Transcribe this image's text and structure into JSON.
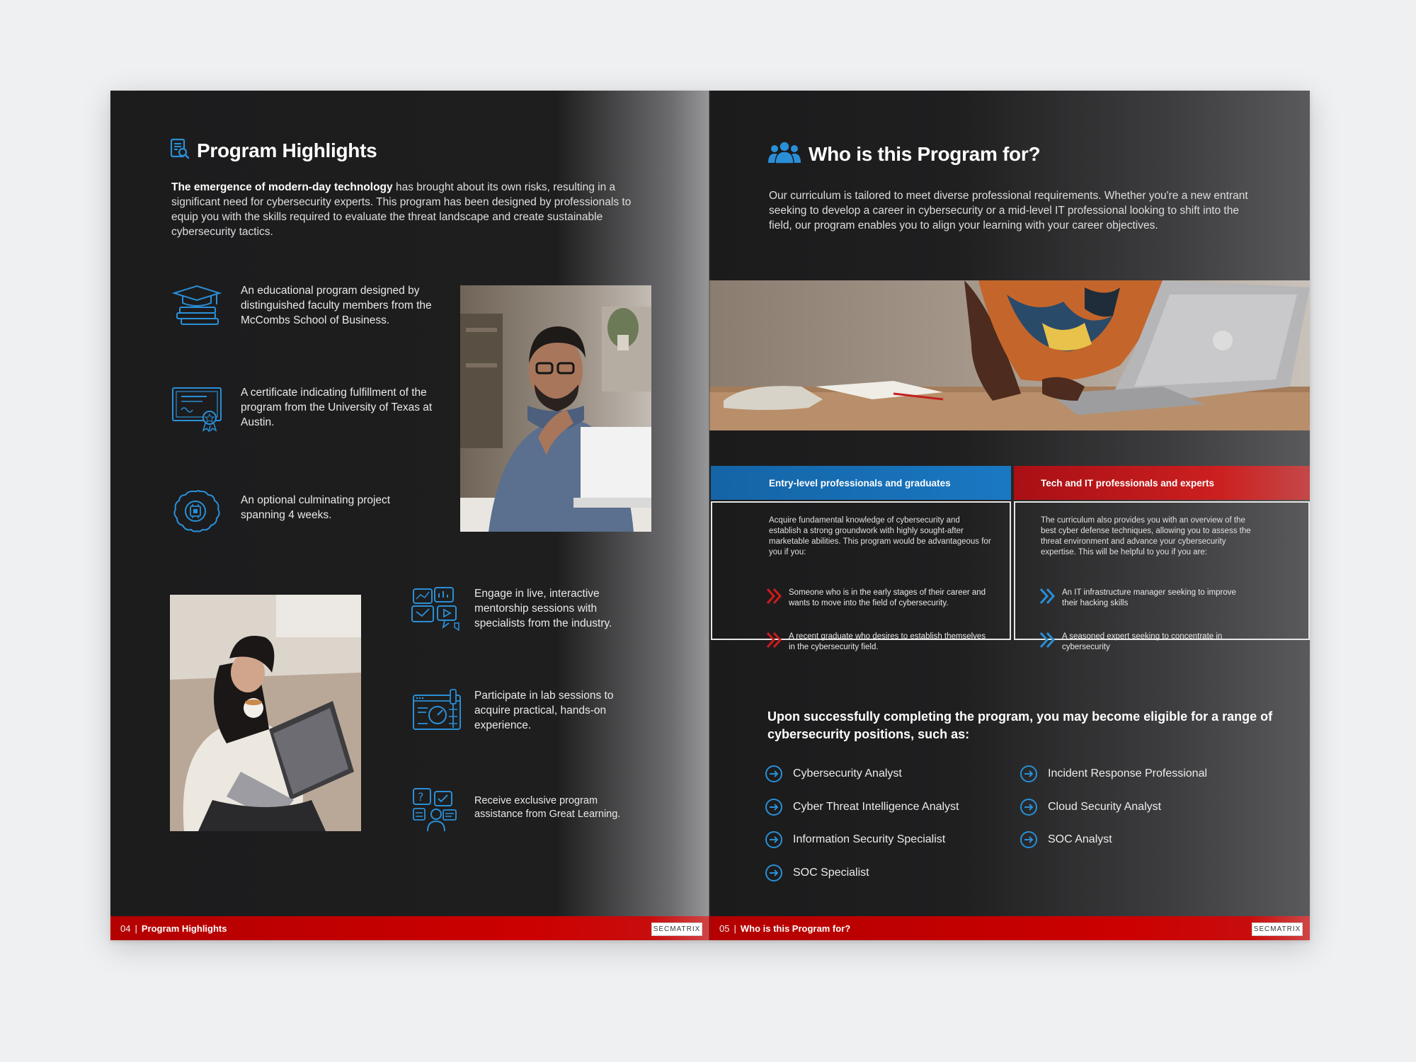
{
  "left_page": {
    "title": "Program Highlights",
    "title_icon": "document-search-icon",
    "intro_bold": "The emergence of modern-day technology",
    "intro_rest": " has brought about its own risks, resulting in a significant need for cybersecurity experts. This program has been designed by professionals to equip you with the skills required to evaluate the threat landscape and create sustainable cybersecurity tactics.",
    "features_top": [
      {
        "icon": "graduation-cap-books-icon",
        "text": "An educational program designed by distinguished faculty members from the McCombs School of Business."
      },
      {
        "icon": "certificate-icon",
        "text": "A certificate indicating fulfillment of the program from the University of Texas at Austin."
      },
      {
        "icon": "brain-chip-icon",
        "text": "An optional culminating project spanning 4 weeks."
      }
    ],
    "features_bottom": [
      {
        "icon": "mentorship-chat-icon",
        "text": "Engage in live, interactive mentorship sessions with specialists from the industry."
      },
      {
        "icon": "lab-dashboard-icon",
        "text": "Participate in lab sessions to acquire practical, hands-on experience."
      },
      {
        "icon": "program-assistance-icon",
        "text": "Receive exclusive program assistance from Great Learning."
      }
    ],
    "footer": {
      "page_number": "04",
      "separator": "|",
      "label": "Program Highlights",
      "logo": "SECMATRIX"
    }
  },
  "right_page": {
    "title": "Who is this Program for?",
    "title_icon": "people-group-icon",
    "intro": "Our curriculum is tailored to meet diverse professional requirements. Whether you're a new entrant seeking to develop a career in cybersecurity or a mid-level IT professional looking to shift into the field, our program enables you to align your learning with your career objectives.",
    "columns": [
      {
        "heading": "Entry-level professionals and graduates",
        "color": "#1a6fb3",
        "intro": "Acquire fundamental knowledge of cybersecurity and establish a strong groundwork with highly sought-after marketable abilities. This program would be advantageous for you if you:",
        "bullet_icon": "red-double-chevron-icon",
        "bullets": [
          "Someone who is in the early stages of their career and wants to move into the field of cybersecurity.",
          "A recent graduate who desires to establish themselves in the cybersecurity field."
        ]
      },
      {
        "heading": "Tech and IT professionals and experts",
        "color": "#b3141a",
        "intro": "The curriculum also provides you with an overview of the best cyber defense techniques, allowing you to assess the threat environment and advance your cybersecurity expertise. This will be helpful to you if you are:",
        "bullet_icon": "blue-double-chevron-icon",
        "bullets": [
          "An IT infrastructure manager seeking to improve their hacking skills",
          "A seasoned expert seeking to concentrate in cybersecurity"
        ]
      }
    ],
    "eligible_heading": "Upon successfully completing the program, you may become eligible for a range of cybersecurity positions, such as:",
    "roles_left": [
      "Cybersecurity Analyst",
      "Cyber Threat Intelligence Analyst",
      "Information Security Specialist",
      "SOC Specialist"
    ],
    "roles_right": [
      "Incident Response Professional",
      "Cloud Security Analyst",
      "SOC Analyst"
    ],
    "role_icon": "circle-arrow-right-icon",
    "footer": {
      "page_number": "05",
      "separator": "|",
      "label": "Who is this Program for?",
      "logo": "SECMATRIX"
    }
  },
  "colors": {
    "accent_blue": "#2a8fd6",
    "accent_red": "#cc0000",
    "page_dark": "#1c1c1d"
  }
}
